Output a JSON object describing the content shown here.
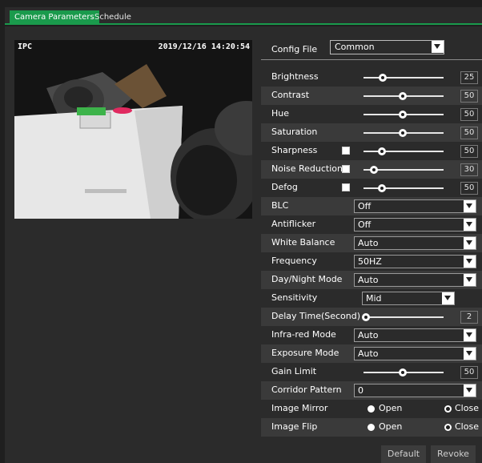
{
  "tabs": [
    {
      "label": "Camera Parameters",
      "active": true
    },
    {
      "label": "Schedule",
      "active": false
    }
  ],
  "video": {
    "osd_left": "IPC",
    "osd_right": "2019/12/16 14:20:54"
  },
  "config": {
    "label": "Config File",
    "value": "Common"
  },
  "sliders": [
    {
      "label": "Brightness",
      "value": "25",
      "level": 0.25,
      "checkbox": false
    },
    {
      "label": "Contrast",
      "value": "50",
      "level": 0.5,
      "checkbox": false
    },
    {
      "label": "Hue",
      "value": "50",
      "level": 0.5,
      "checkbox": false
    },
    {
      "label": "Saturation",
      "value": "50",
      "level": 0.5,
      "checkbox": false
    },
    {
      "label": "Sharpness",
      "value": "50",
      "level": 0.25,
      "checkbox": true
    },
    {
      "label": "Noise Reduction",
      "value": "30",
      "level": 0.12,
      "checkbox": true
    },
    {
      "label": "Defog",
      "value": "50",
      "level": 0.25,
      "checkbox": true
    }
  ],
  "selects": [
    {
      "label": "BLC",
      "value": "Off"
    },
    {
      "label": "Antiflicker",
      "value": "Off"
    },
    {
      "label": "White Balance",
      "value": "Auto"
    },
    {
      "label": "Frequency",
      "value": "50HZ"
    },
    {
      "label": "Day/Night Mode",
      "value": "Auto"
    }
  ],
  "sensitivity": {
    "label": "Sensitivity",
    "value": "Mid"
  },
  "delay": {
    "label": "Delay Time(Second)",
    "value": "2",
    "level": 0.0
  },
  "selects2": [
    {
      "label": "Infra-red Mode",
      "value": "Auto"
    },
    {
      "label": "Exposure Mode",
      "value": "Auto"
    }
  ],
  "gain": {
    "label": "Gain Limit",
    "value": "50",
    "level": 0.5
  },
  "corridor": {
    "label": "Corridor Pattern",
    "value": "0"
  },
  "mirror": {
    "label": "Image Mirror",
    "open": "Open",
    "close": "Close",
    "selected": "Close"
  },
  "flip": {
    "label": "Image Flip",
    "open": "Open",
    "close": "Close",
    "selected": "Close"
  },
  "buttons": {
    "default": "Default",
    "revoke": "Revoke"
  }
}
